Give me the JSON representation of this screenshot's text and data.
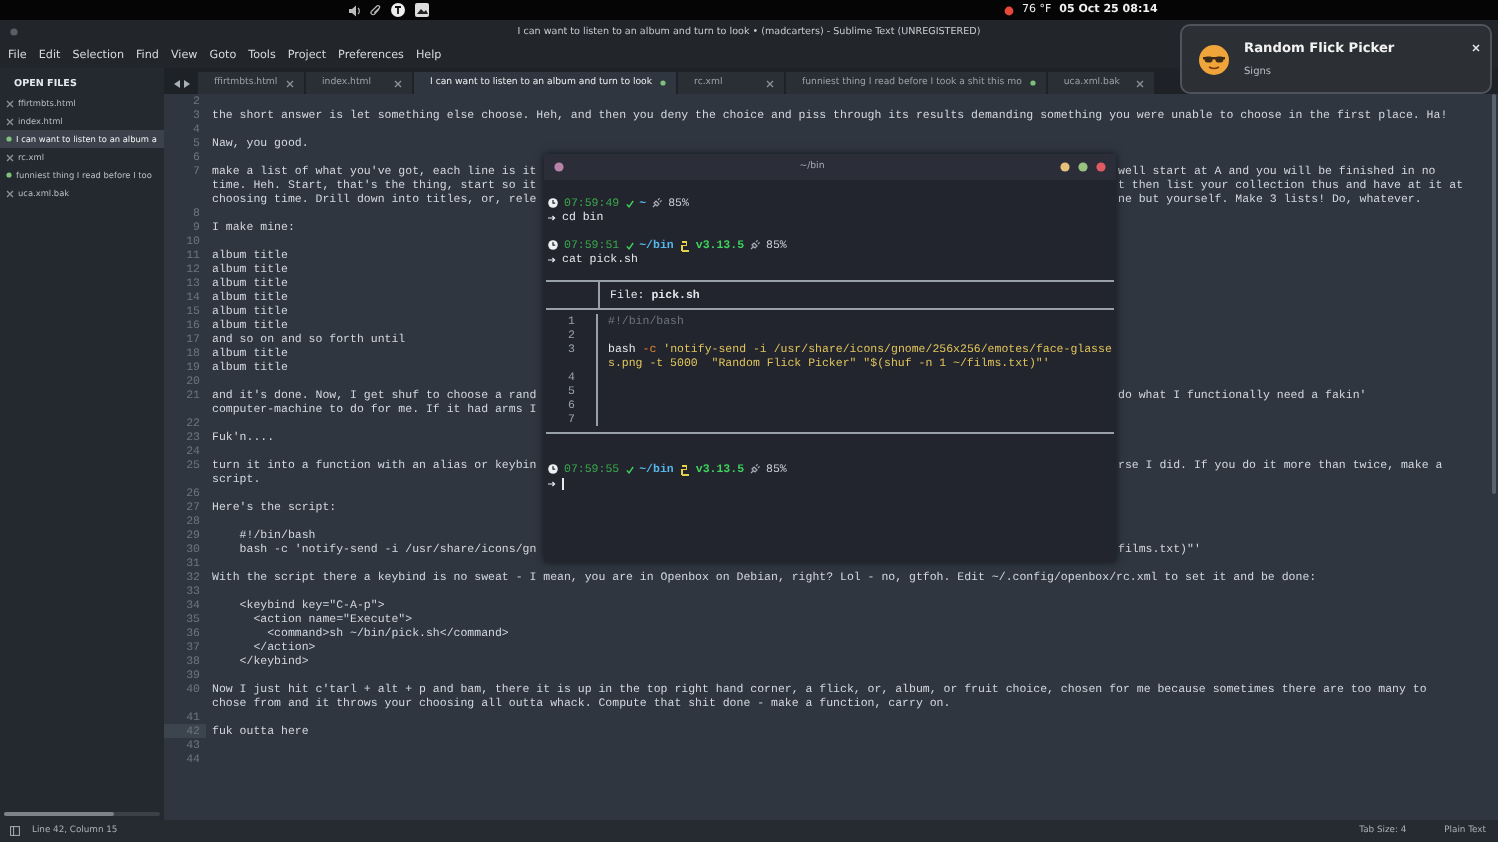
{
  "panel": {
    "weather": "76 °F",
    "clock": "05 Oct 25 08:14"
  },
  "window": {
    "title": "I can want to listen to an album and turn to look • (madcarters) - Sublime Text (UNREGISTERED)"
  },
  "menu": [
    "File",
    "Edit",
    "Selection",
    "Find",
    "View",
    "Goto",
    "Tools",
    "Project",
    "Preferences",
    "Help"
  ],
  "sidebar": {
    "header": "OPEN FILES",
    "items": [
      {
        "label": "ffirtmbts.html",
        "selected": false,
        "modified": false
      },
      {
        "label": "index.html",
        "selected": false,
        "modified": false
      },
      {
        "label": "I can want to listen to an album a",
        "selected": true,
        "modified": true
      },
      {
        "label": "rc.xml",
        "selected": false,
        "modified": false
      },
      {
        "label": "funniest thing I read before I too",
        "selected": false,
        "modified": true
      },
      {
        "label": "uca.xml.bak",
        "selected": false,
        "modified": false
      }
    ]
  },
  "tabs": [
    {
      "label": "ffirtmbts.html",
      "selected": false,
      "modified": false
    },
    {
      "label": "index.html",
      "selected": false,
      "modified": false
    },
    {
      "label": "I can want to listen to an album and turn to look",
      "selected": true,
      "modified": true
    },
    {
      "label": "rc.xml",
      "selected": false,
      "modified": false
    },
    {
      "label": "funniest thing I read before I took a shit this mo",
      "selected": false,
      "modified": true
    },
    {
      "label": "uca.xml.bak",
      "selected": false,
      "modified": false
    }
  ],
  "editor": {
    "lines": [
      {
        "n": "2",
        "current": false
      },
      {
        "n": "3",
        "current": false,
        "rows": [
          {
            "text": "the short answer is let something else choose. Heh, and then you deny the choice and piss through its results demanding something you were unable to choose in the first place. Ha!"
          }
        ]
      },
      {
        "n": "4",
        "current": false
      },
      {
        "n": "5",
        "current": false,
        "rows": [
          {
            "text": "Naw, you good."
          }
        ]
      },
      {
        "n": "6",
        "current": false
      },
      {
        "n": "7",
        "current": false,
        "rows": [
          {
            "left": "make a list of what you've got, each line is it",
            "right": "well start at A and you will be finished in no"
          },
          {
            "left": "time. Heh. Start, that's the thing, start so it",
            "right": "t then list your collection thus and have at it at"
          },
          {
            "left": "choosing time. Drill down into titles, or, rele",
            "right": "ne but yourself. Make 3 lists! Do, whatever."
          }
        ]
      },
      {
        "n": "8",
        "current": false
      },
      {
        "n": "9",
        "current": false,
        "rows": [
          {
            "text": "I make mine:"
          }
        ]
      },
      {
        "n": "10",
        "current": false
      },
      {
        "n": "11",
        "current": false,
        "rows": [
          {
            "text": "album title"
          }
        ]
      },
      {
        "n": "12",
        "current": false,
        "rows": [
          {
            "text": "album title"
          }
        ]
      },
      {
        "n": "13",
        "current": false,
        "rows": [
          {
            "text": "album title"
          }
        ]
      },
      {
        "n": "14",
        "current": false,
        "rows": [
          {
            "text": "album title"
          }
        ]
      },
      {
        "n": "15",
        "current": false,
        "rows": [
          {
            "text": "album title"
          }
        ]
      },
      {
        "n": "16",
        "current": false,
        "rows": [
          {
            "text": "album title"
          }
        ]
      },
      {
        "n": "17",
        "current": false,
        "rows": [
          {
            "text": "and so on and so forth until"
          }
        ]
      },
      {
        "n": "18",
        "current": false,
        "rows": [
          {
            "text": "album title"
          }
        ]
      },
      {
        "n": "19",
        "current": false,
        "rows": [
          {
            "text": "album title"
          }
        ]
      },
      {
        "n": "20",
        "current": false
      },
      {
        "n": "21",
        "current": false,
        "rows": [
          {
            "left": "and it's done. Now, I get shuf to choose a rand",
            "right": "do what I functionally need a fakin'"
          },
          {
            "left": "computer-machine to do for me. If it had arms I"
          }
        ]
      },
      {
        "n": "22",
        "current": false
      },
      {
        "n": "23",
        "current": false,
        "rows": [
          {
            "text": "Fuk'n...."
          }
        ]
      },
      {
        "n": "24",
        "current": false
      },
      {
        "n": "25",
        "current": false,
        "rows": [
          {
            "left": "turn it into a function with an alias or keybin",
            "right": "rse I did. If you do it more than twice, make a"
          },
          {
            "text": "script."
          }
        ]
      },
      {
        "n": "26",
        "current": false
      },
      {
        "n": "27",
        "current": false,
        "rows": [
          {
            "text": "Here's the script:"
          }
        ]
      },
      {
        "n": "28",
        "current": false
      },
      {
        "n": "29",
        "current": false,
        "rows": [
          {
            "text": "    #!/bin/bash"
          }
        ]
      },
      {
        "n": "30",
        "current": false,
        "rows": [
          {
            "left": "    bash -c 'notify-send -i /usr/share/icons/gn",
            "right": "films.txt)\"'"
          }
        ]
      },
      {
        "n": "31",
        "current": false
      },
      {
        "n": "32",
        "current": false,
        "rows": [
          {
            "text": "With the script there a keybind is no sweat - I mean, you are in Openbox on Debian, right? Lol - no, gtfoh. Edit ~/.config/openbox/rc.xml to set it and be done:"
          }
        ]
      },
      {
        "n": "33",
        "current": false
      },
      {
        "n": "34",
        "current": false,
        "rows": [
          {
            "text": "    <keybind key=\"C-A-p\">"
          }
        ]
      },
      {
        "n": "35",
        "current": false,
        "rows": [
          {
            "text": "      <action name=\"Execute\">"
          }
        ]
      },
      {
        "n": "36",
        "current": false,
        "rows": [
          {
            "text": "        <command>sh ~/bin/pick.sh</command>"
          }
        ]
      },
      {
        "n": "37",
        "current": false,
        "rows": [
          {
            "text": "      </action>"
          }
        ]
      },
      {
        "n": "38",
        "current": false,
        "rows": [
          {
            "text": "    </keybind>"
          }
        ]
      },
      {
        "n": "39",
        "current": false
      },
      {
        "n": "40",
        "current": false,
        "rows": [
          {
            "text": "Now I just hit c'tarl + alt + p and bam, there it is up in the top right hand corner, a flick, or, album, or fruit choice, chosen for me because sometimes there are too many to"
          },
          {
            "text": "chose from and it throws your choosing all outta whack. Compute that shit done - make a function, carry on."
          }
        ]
      },
      {
        "n": "41",
        "current": false
      },
      {
        "n": "42",
        "current": true,
        "rows": [
          {
            "text": "fuk outta here"
          }
        ]
      },
      {
        "n": "43",
        "current": false
      },
      {
        "n": "44",
        "current": false
      }
    ]
  },
  "status_bar": {
    "position": "Line 42, Column 15",
    "tab_size": "Tab Size: 4",
    "syntax": "Plain Text"
  },
  "terminal": {
    "title": "~/bin",
    "blocks": [
      {
        "kind": "prompt",
        "time": "07:59:49",
        "path": "~",
        "battery": "85%",
        "command": "cd bin",
        "cursor": false
      },
      {
        "kind": "prompt",
        "time": "07:59:51",
        "path": "~/bin",
        "version": "v3.13.5",
        "battery": "85%",
        "command": "cat pick.sh",
        "cursor": false
      },
      {
        "kind": "file",
        "header": "File: **pick.sh**",
        "lines": [
          {
            "num": "1",
            "kind": "comment",
            "text": "#!/bin/bash"
          },
          {
            "num": "2",
            "kind": "blank"
          },
          {
            "num": "3",
            "kind": "command",
            "program": "bash",
            "flag": "-c",
            "argument": "'notify-send -i /usr/share/icons/gnome/256x256/emotes/face-glasses.png -t 5000  \"Random Flick Picker\" \"$(shuf -n 1 ~/films.txt)\"'"
          },
          {
            "num": "4",
            "kind": "blank"
          },
          {
            "num": "5",
            "kind": "blank"
          },
          {
            "num": "6",
            "kind": "blank"
          },
          {
            "num": "7",
            "kind": "blank"
          }
        ]
      },
      {
        "kind": "prompt",
        "time": "07:59:55",
        "path": "~/bin",
        "version": "v3.13.5",
        "battery": "85%",
        "cursor": true
      }
    ]
  },
  "notification": {
    "title": "Random Flick Picker",
    "body": "Signs"
  }
}
